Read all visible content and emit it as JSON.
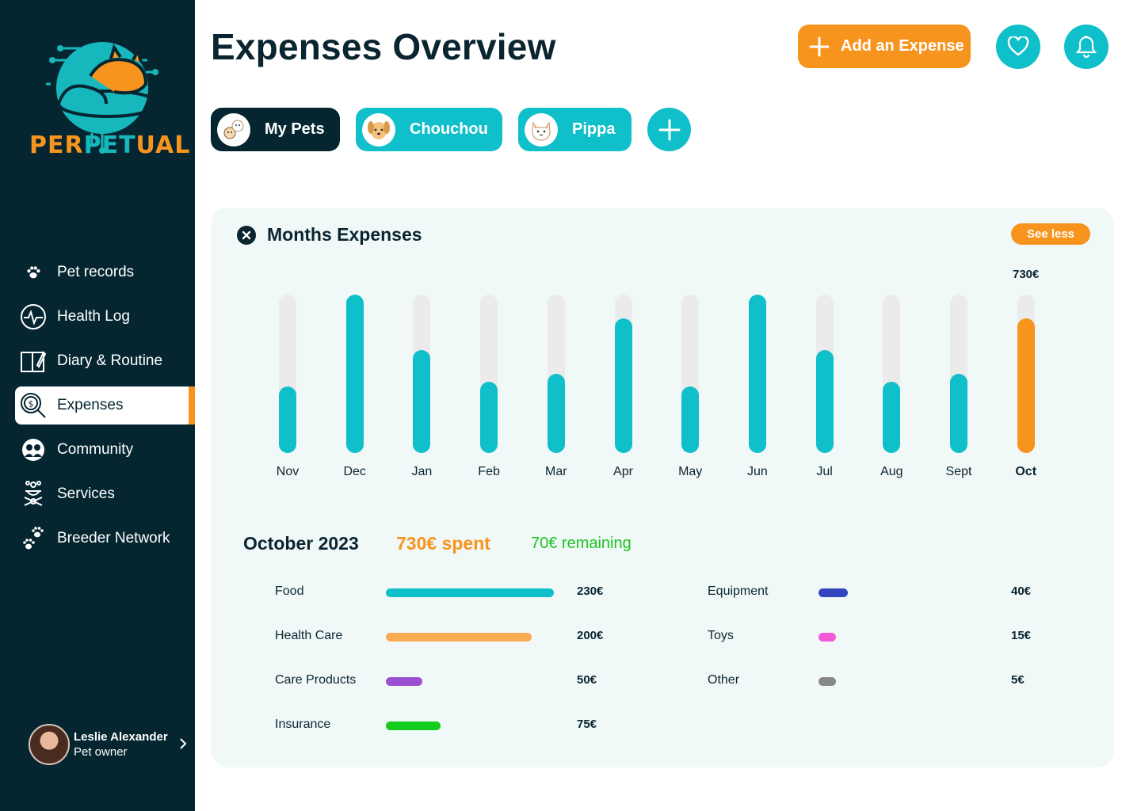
{
  "app": {
    "logo_text_a": "PER",
    "logo_text_b": "PET",
    "logo_text_c": "UAL"
  },
  "sidebar": {
    "items": [
      {
        "label": "Pet records",
        "icon": "paw-icon"
      },
      {
        "label": "Health Log",
        "icon": "heartbeat-icon"
      },
      {
        "label": "Diary & Routine",
        "icon": "notebook-icon"
      },
      {
        "label": "Expenses",
        "icon": "money-search-icon",
        "active": true
      },
      {
        "label": "Community",
        "icon": "community-icon"
      },
      {
        "label": "Services",
        "icon": "services-icon"
      },
      {
        "label": "Breeder Network",
        "icon": "paws-icon"
      }
    ],
    "user": {
      "name": "Leslie Alexander",
      "role": "Pet owner"
    }
  },
  "header": {
    "title": "Expenses Overview",
    "add_label": "Add an Expense"
  },
  "pets": {
    "tabs": [
      {
        "label": "My Pets",
        "active": true
      },
      {
        "label": "Chouchou",
        "active": false
      },
      {
        "label": "Pippa",
        "active": false
      }
    ]
  },
  "card": {
    "title": "Months Expenses",
    "see_less": "See less"
  },
  "chart_data": {
    "type": "bar",
    "categories": [
      "Nov",
      "Dec",
      "Jan",
      "Feb",
      "Mar",
      "Apr",
      "May",
      "Jun",
      "Jul",
      "Aug",
      "Sept",
      "Oct"
    ],
    "values": [
      0.42,
      1.0,
      0.65,
      0.45,
      0.5,
      0.85,
      0.42,
      1.0,
      0.65,
      0.45,
      0.5,
      0.85
    ],
    "highlighted": "Oct",
    "highlighted_label": "730€",
    "colors": {
      "default": "#0fbfc9",
      "highlight": "#f7941d",
      "track": "#ebebeb"
    }
  },
  "summary": {
    "month": "October 2023",
    "spent": "730€ spent",
    "remaining": "70€ remaining"
  },
  "categories": [
    {
      "label": "Food",
      "value": "230€",
      "amount": 230,
      "color": "#0fbfc9"
    },
    {
      "label": "Health Care",
      "value": "200€",
      "amount": 200,
      "color": "#fbaa54"
    },
    {
      "label": "Care Products",
      "value": "50€",
      "amount": 50,
      "color": "#9b4fd1"
    },
    {
      "label": "Insurance",
      "value": "75€",
      "amount": 75,
      "color": "#14cc1e"
    },
    {
      "label": "Equipment",
      "value": "40€",
      "amount": 40,
      "color": "#3344c0"
    },
    {
      "label": "Toys",
      "value": "15€",
      "amount": 15,
      "color": "#f55ad6"
    },
    {
      "label": "Other",
      "value": "5€",
      "amount": 5,
      "color": "#888888"
    }
  ]
}
